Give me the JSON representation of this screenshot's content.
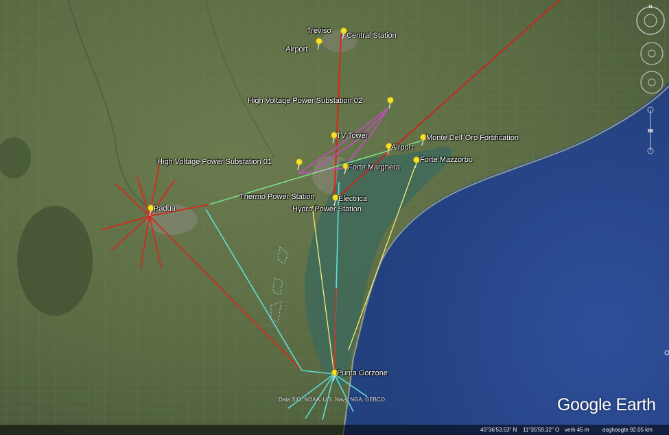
{
  "map": {
    "app": "Google Earth",
    "attribution": "Data SIO, NOAA, U.S. Navy, NGA, GEBCO",
    "status": {
      "latitude": "45°36'53.53\" N",
      "longitude": "11°35'59.32\" O",
      "elevation": "verh   45 m",
      "eye_altitude": "ooghoogte   92.05 km"
    },
    "compass_north": "N",
    "placemarks": [
      {
        "label": "Treviso"
      },
      {
        "label": "Central Station"
      },
      {
        "label": "Airport"
      },
      {
        "label": "High Voltage Power Substation 02"
      },
      {
        "label": "TV Tower"
      },
      {
        "label": "Airport"
      },
      {
        "label": "Monte Dell''Oro Fortification"
      },
      {
        "label": "High Voltage Power Substation 01"
      },
      {
        "label": "Forte Marghera"
      },
      {
        "label": "Forte Mazzorbo"
      },
      {
        "label": "Padua"
      },
      {
        "label": "Thermo Power Station"
      },
      {
        "label": "Electrica"
      },
      {
        "label": "Hydro Power Station"
      },
      {
        "label": "Punta Gorzone"
      }
    ],
    "line_colors": {
      "red": "#d42a1e",
      "cyan": "#5fe0d8",
      "yellow": "#f2f07a",
      "green": "#7cf08a",
      "magenta": "#c84cc8"
    }
  }
}
